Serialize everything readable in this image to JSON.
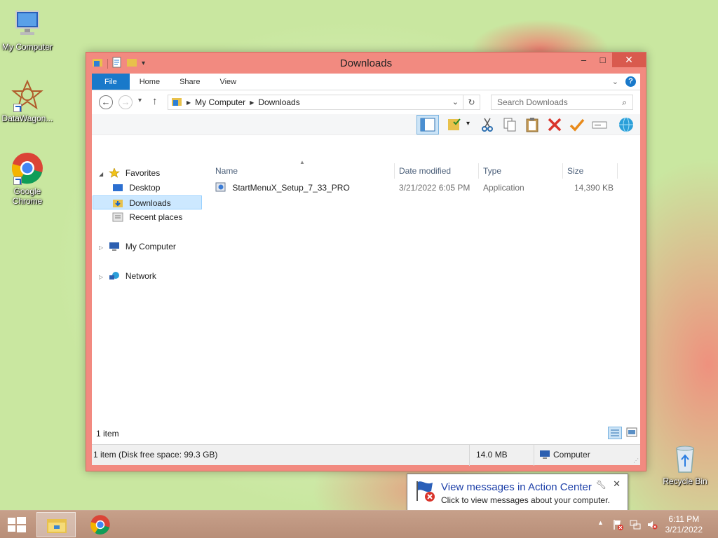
{
  "desktop": {
    "icons": [
      {
        "label": "My Computer",
        "icon": "computer-icon"
      },
      {
        "label": "DataWagon...",
        "icon": "datawagon-icon"
      },
      {
        "label": "Google Chrome",
        "icon": "chrome-icon"
      },
      {
        "label": "Recycle Bin",
        "icon": "recycle-bin-icon"
      }
    ]
  },
  "window": {
    "title": "Downloads",
    "ribbon_tabs": [
      "File",
      "Home",
      "Share",
      "View"
    ],
    "address": {
      "segments": [
        "My Computer",
        "Downloads"
      ]
    },
    "search_placeholder": "Search Downloads",
    "nav_pane": {
      "favorites": "Favorites",
      "favorites_items": [
        "Desktop",
        "Downloads",
        "Recent places"
      ],
      "my_computer": "My Computer",
      "network": "Network"
    },
    "columns": [
      "Name",
      "Date modified",
      "Type",
      "Size"
    ],
    "files": [
      {
        "name": "StartMenuX_Setup_7_33_PRO",
        "date": "3/21/2022 6:05 PM",
        "type": "Application",
        "size": "14,390 KB"
      }
    ],
    "item_count": "1 item",
    "status": {
      "disk": "1 item (Disk free space: 99.3 GB)",
      "size": "14.0 MB",
      "location": "Computer"
    }
  },
  "balloon": {
    "title": "View messages in Action Center",
    "text": "Click to view messages about your computer."
  },
  "taskbar": {
    "time": "6:11 PM",
    "date": "3/21/2022"
  },
  "colors": {
    "window_frame": "#f28a80",
    "accent": "#1979ca",
    "selection": "#cce8ff"
  }
}
